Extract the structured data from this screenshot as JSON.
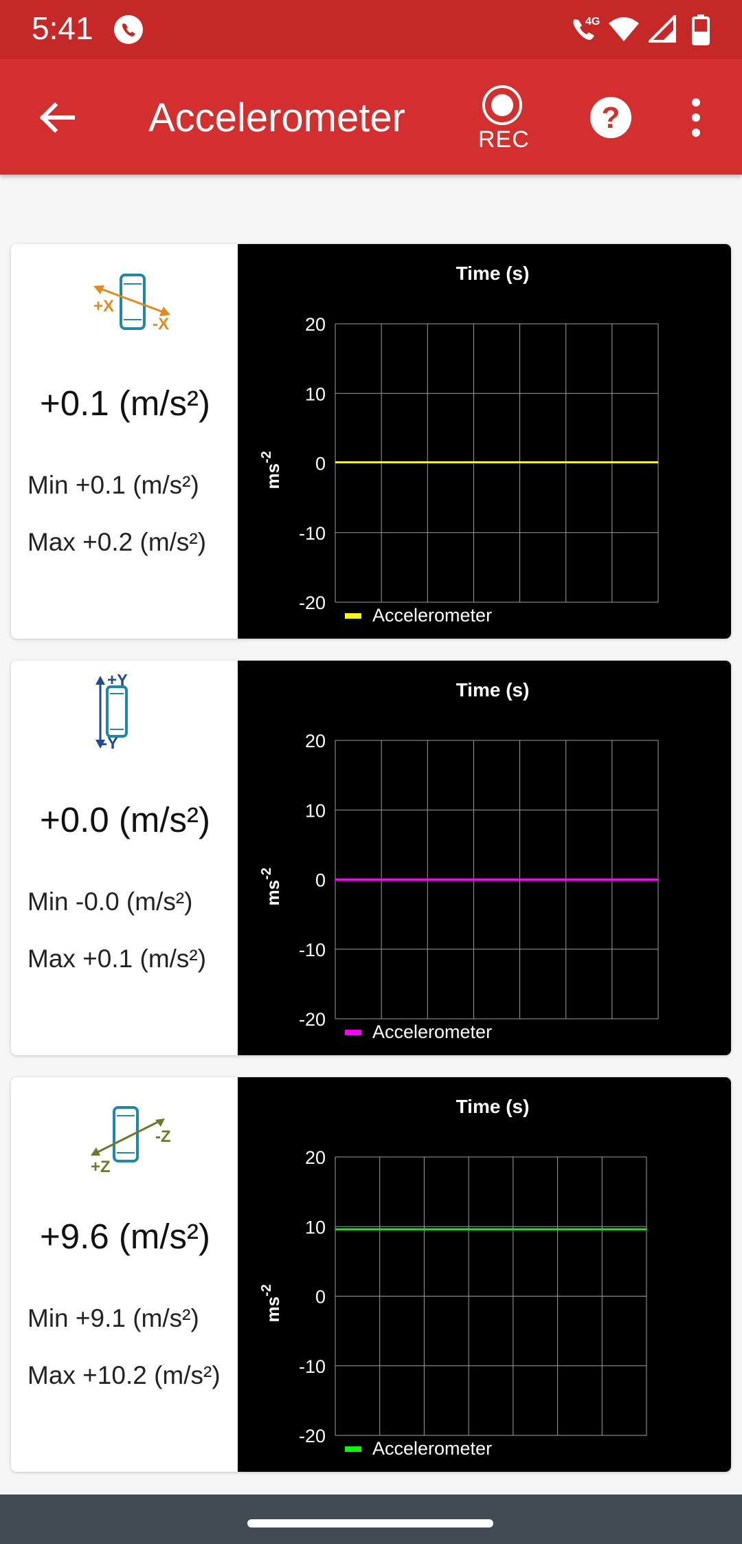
{
  "status_bar": {
    "time": "5:41",
    "network": "4G"
  },
  "app_bar": {
    "title": "Accelerometer",
    "rec_label": "REC"
  },
  "icons": [
    "back-arrow-icon",
    "record-icon",
    "help-icon",
    "overflow-menu-icon",
    "phone-call-icon",
    "wifi-icon",
    "signal-icon",
    "battery-icon"
  ],
  "colors": {
    "app_bar": "#d32f2f",
    "status_bar": "#c62828",
    "x_series": "#ffff00",
    "y_series": "#ff00ff",
    "z_series": "#00ff00",
    "x_icon": "#e08a1e",
    "y_icon": "#1f4e8c",
    "z_icon": "#6b7a2a"
  },
  "cards": [
    {
      "axis_plus": "+X",
      "axis_minus": "-X",
      "value": "+0.1 (m/s²)",
      "min": "Min +0.1 (m/s²)",
      "max": "Max +0.2 (m/s²)",
      "title": "Time (s)",
      "ylabel_base": "ms",
      "ylabel_exp": "-2",
      "legend": "Accelerometer",
      "yticks": [
        "20",
        "10",
        "0",
        "-10",
        "-20"
      ]
    },
    {
      "axis_plus": "+Y",
      "axis_minus": "-Y",
      "value": "+0.0 (m/s²)",
      "min": "Min -0.0 (m/s²)",
      "max": "Max +0.1 (m/s²)",
      "title": "Time (s)",
      "ylabel_base": "ms",
      "ylabel_exp": "-2",
      "legend": "Accelerometer",
      "yticks": [
        "20",
        "10",
        "0",
        "-10",
        "-20"
      ]
    },
    {
      "axis_plus": "+Z",
      "axis_minus": "-Z",
      "value": "+9.6 (m/s²)",
      "min": "Min +9.1 (m/s²)",
      "max": "Max +10.2 (m/s²)",
      "title": "Time (s)",
      "ylabel_base": "ms",
      "ylabel_exp": "-2",
      "legend": "Accelerometer",
      "yticks": [
        "20",
        "10",
        "0",
        "-10",
        "-20"
      ]
    }
  ],
  "chart_data": [
    {
      "type": "line",
      "title": "Time (s)",
      "ylabel": "ms-2",
      "ylim": [
        -20,
        20
      ],
      "yticks": [
        20,
        10,
        0,
        -10,
        -20
      ],
      "grid": true,
      "legend_position": "bottom-left",
      "series": [
        {
          "name": "Accelerometer",
          "color": "#ffff00",
          "values": [
            0.1,
            0.1,
            0.1,
            0.1,
            0.1,
            0.1,
            0.1,
            0.1
          ]
        }
      ]
    },
    {
      "type": "line",
      "title": "Time (s)",
      "ylabel": "ms-2",
      "ylim": [
        -20,
        20
      ],
      "yticks": [
        20,
        10,
        0,
        -10,
        -20
      ],
      "grid": true,
      "legend_position": "bottom-left",
      "series": [
        {
          "name": "Accelerometer",
          "color": "#ff00ff",
          "values": [
            0.0,
            0.0,
            0.0,
            0.0,
            0.0,
            0.0,
            0.0,
            0.0
          ]
        }
      ]
    },
    {
      "type": "line",
      "title": "Time (s)",
      "ylabel": "ms-2",
      "ylim": [
        -20,
        20
      ],
      "yticks": [
        20,
        10,
        0,
        -10,
        -20
      ],
      "grid": true,
      "legend_position": "bottom-left",
      "series": [
        {
          "name": "Accelerometer",
          "color": "#00ff00",
          "values": [
            9.6,
            9.6,
            9.6,
            9.6,
            9.6,
            9.6,
            9.6,
            9.6
          ]
        }
      ]
    }
  ]
}
